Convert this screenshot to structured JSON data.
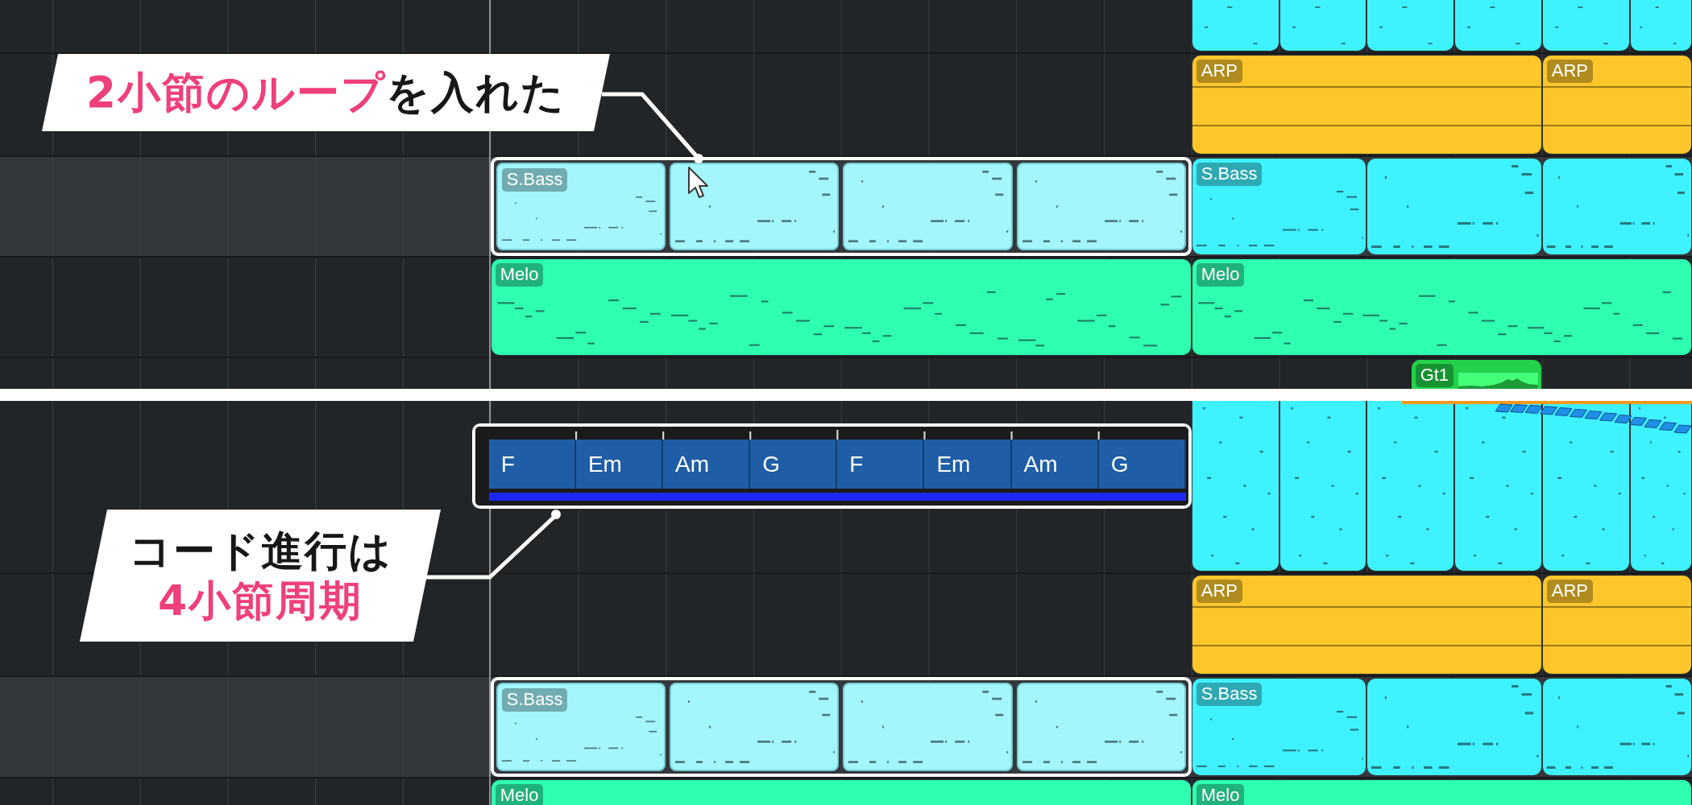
{
  "panels": [
    {
      "rows": [
        {
          "selected": false,
          "clips": [
            {
              "kind": "notes",
              "color": "#3ff2ff"
            },
            {
              "kind": "notes",
              "color": "#3ff2ff"
            },
            {
              "kind": "notes",
              "color": "#3ff2ff"
            },
            {
              "kind": "notes",
              "color": "#3ff2ff"
            },
            {
              "kind": "notes",
              "color": "#3ff2ff"
            },
            {
              "kind": "notes",
              "color": "#3ff2ff"
            }
          ]
        },
        {
          "selected": false,
          "clips": [
            {
              "kind": "arp",
              "color": "#fdc72c",
              "label": "ARP"
            },
            {
              "kind": "arp",
              "color": "#fdc72c",
              "label": "ARP"
            }
          ]
        },
        {
          "selected": true,
          "clips": [
            {
              "kind": "loop",
              "highlighted": true,
              "clips": [
                {
                  "color": "#a3f6fc",
                  "label": "S.Bass"
                },
                {
                  "color": "#a3f6fc"
                },
                {
                  "color": "#a3f6fc"
                },
                {
                  "color": "#a3f6fc"
                }
              ]
            },
            {
              "kind": "notes",
              "color": "#3ff2ff",
              "label": "S.Bass"
            },
            {
              "kind": "notes",
              "color": "#3ff2ff"
            },
            {
              "kind": "notes",
              "color": "#3ff2ff"
            }
          ]
        },
        {
          "selected": false,
          "clips": [
            {
              "kind": "notes",
              "color": "#2effb1",
              "label": "Melo"
            },
            {
              "kind": "notes",
              "color": "#2effb1",
              "label": "Melo"
            }
          ]
        },
        {
          "selected": false,
          "clips": [
            {
              "kind": "audio",
              "color": "#22d24a",
              "label": "Gt1"
            }
          ]
        }
      ],
      "callout": {
        "lines": [
          [
            {
              "text": "2小節のループ",
              "emphasis": true
            },
            {
              "text": "を入れた",
              "emphasis": false
            }
          ]
        ]
      }
    },
    {
      "rows": [
        {
          "selected": false,
          "clips": [
            {
              "kind": "chords",
              "highlighted": true,
              "chords": [
                "F",
                "Em",
                "Am",
                "G",
                "F",
                "Em",
                "Am",
                "G"
              ]
            },
            {
              "kind": "notes",
              "color": "#3ff2ff"
            },
            {
              "kind": "notes",
              "color": "#3ff2ff"
            },
            {
              "kind": "notes",
              "color": "#3ff2ff"
            },
            {
              "kind": "notes",
              "color": "#3ff2ff"
            },
            {
              "kind": "notes",
              "color": "#3ff2ff"
            },
            {
              "kind": "notes",
              "color": "#3ff2ff"
            }
          ]
        },
        {
          "selected": false,
          "clips": [
            {
              "kind": "arp",
              "color": "#fdc72c",
              "label": "ARP"
            },
            {
              "kind": "arp",
              "color": "#fdc72c",
              "label": "ARP"
            }
          ]
        },
        {
          "selected": true,
          "clips": [
            {
              "kind": "loop",
              "highlighted": true,
              "clips": [
                {
                  "color": "#a3f6fc",
                  "label": "S.Bass"
                },
                {
                  "color": "#a3f6fc"
                },
                {
                  "color": "#a3f6fc"
                },
                {
                  "color": "#a3f6fc"
                }
              ]
            },
            {
              "kind": "notes",
              "color": "#3ff2ff",
              "label": "S.Bass"
            },
            {
              "kind": "notes",
              "color": "#3ff2ff"
            },
            {
              "kind": "notes",
              "color": "#3ff2ff"
            }
          ]
        },
        {
          "selected": false,
          "clips": [
            {
              "kind": "notes",
              "color": "#2effb1",
              "label": "Melo"
            },
            {
              "kind": "notes",
              "color": "#2effb1",
              "label": "Melo"
            }
          ]
        }
      ],
      "callout": {
        "lines": [
          [
            {
              "text": "コード進行は",
              "emphasis": false
            }
          ],
          [
            {
              "text": "4小節周期",
              "emphasis": true
            }
          ]
        ]
      }
    }
  ]
}
